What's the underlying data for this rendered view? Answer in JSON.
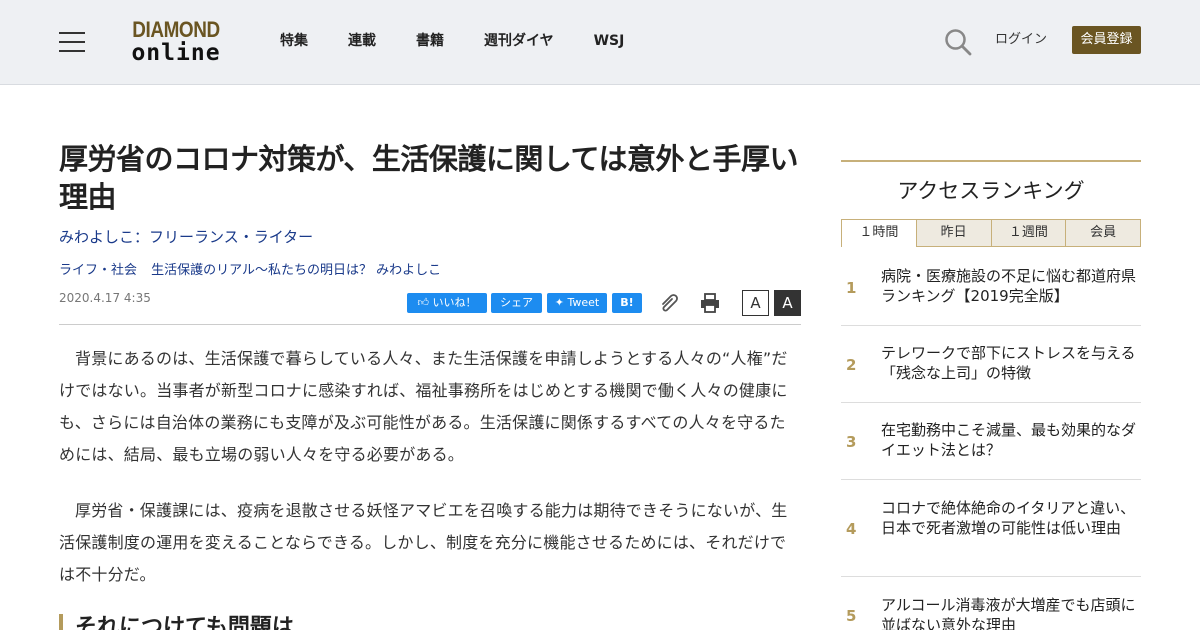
{
  "header": {
    "logo_line1": "DIAMOND",
    "logo_line2": "online",
    "nav": [
      "特集",
      "連載",
      "書籍",
      "週刊ダイヤ",
      "WSJ"
    ],
    "login_label": "ログイン",
    "register_label": "会員登録"
  },
  "article": {
    "title": "厚労省のコロナ対策が、生活保護に関しては意外と手厚い理由",
    "author": "みわよしこ：フリーランス・ライター",
    "tags": [
      "ライフ・社会",
      "生活保護のリアル～私たちの明日は？ みわよしこ"
    ],
    "date": "2020.4.17 4:35",
    "share": {
      "like_label": "いいね！",
      "share_label": "シェア",
      "tweet_label": "Tweet",
      "hatena_label": "B!"
    },
    "font_small_label": "A",
    "font_large_label": "A",
    "paragraphs": [
      "背景にあるのは、生活保護で暮らしている人々、また生活保護を申請しようとする人々の“人権”だけではない。当事者が新型コロナに感染すれば、福祉事務所をはじめとする機関で働く人々の健康にも、さらには自治体の業務にも支障が及ぶ可能性がある。生活保護に関係するすべての人々を守るためには、結局、最も立場の弱い人々を守る必要がある。",
      "厚労省・保護課には、疫病を退散させる妖怪アマビエを召喚する能力は期待できそうにないが、生活保護制度の運用を変えることならできる。しかし、制度を充分に機能させるためには、それだけでは不十分だ。"
    ],
    "subheading": "それにつけても問題は"
  },
  "sidebar": {
    "title": "アクセスランキング",
    "tabs": [
      "１時間",
      "昨日",
      "１週間",
      "会員"
    ],
    "ranking": [
      {
        "rank": "1",
        "text": "病院・医療施設の不足に悩む都道府県ランキング【2019完全版】"
      },
      {
        "rank": "2",
        "text": "テレワークで部下にストレスを与える「残念な上司」の特徴"
      },
      {
        "rank": "3",
        "text": "在宅勤務中こそ減量、最も効果的なダイエット法とは？"
      },
      {
        "rank": "4",
        "text": "コロナで絶体絶命のイタリアと違い、日本で死者激増の可能性は低い理由"
      },
      {
        "rank": "5",
        "text": "アルコール消毒液が大増産でも店頭に並ばない意外な理由"
      }
    ]
  },
  "colors": {
    "brand_gold": "#6a5522",
    "accent": "#b49b5c",
    "link_blue": "#1a3a8a",
    "facebook_blue": "#1d8cf0",
    "header_bg": "#eef0f3"
  }
}
